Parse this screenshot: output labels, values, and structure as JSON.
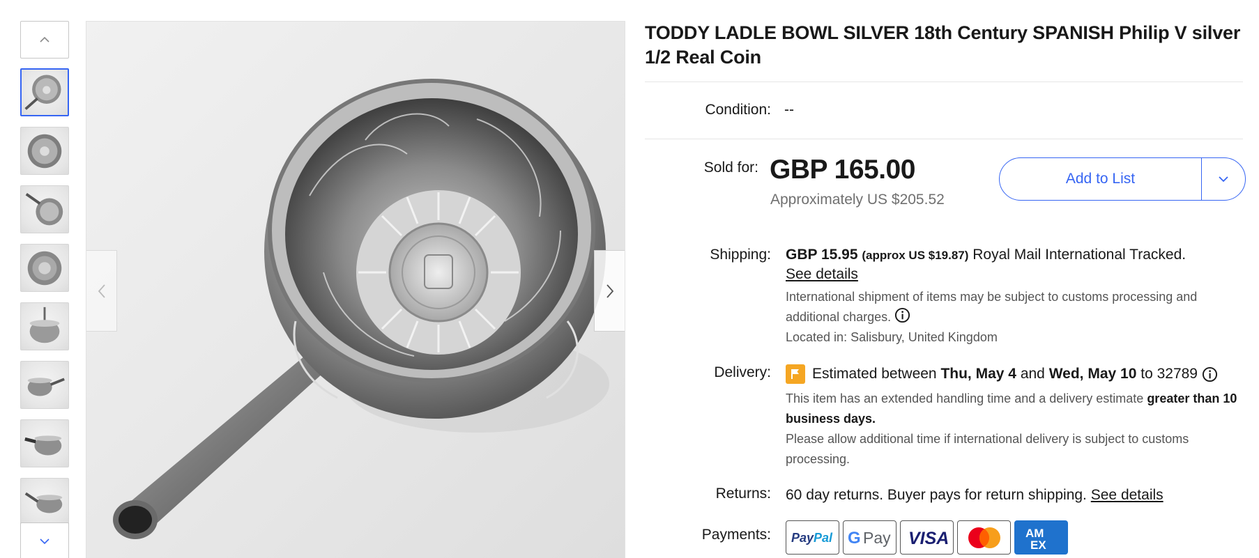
{
  "listing": {
    "title": "TODDY LADLE BOWL SILVER 18th Century SPANISH Philip V silver 1/2 Real Coin"
  },
  "condition": {
    "label": "Condition:",
    "value": "--"
  },
  "price": {
    "label": "Sold for:",
    "amount": "GBP 165.00",
    "approx": "Approximately US $205.52"
  },
  "add_to_list": {
    "label": "Add to List"
  },
  "shipping": {
    "label": "Shipping:",
    "cost": "GBP 15.95",
    "cost_approx": "(approx US $19.87)",
    "service": "Royal Mail International Tracked.",
    "see_details": "See details",
    "customs_note": "International shipment of items may be subject to customs processing and additional charges.",
    "location": "Located in: Salisbury, United Kingdom"
  },
  "delivery": {
    "label": "Delivery:",
    "prefix": "Estimated between",
    "start_date": "Thu, May 4",
    "and_word": "and",
    "end_date": "Wed, May 10",
    "to_word": "to",
    "zip": "32789",
    "handling_note": "This item has an extended handling time and a delivery estimate",
    "handling_note_bold": "greater than 10 business days.",
    "intl_note": "Please allow additional time if international delivery is subject to customs processing."
  },
  "returns": {
    "label": "Returns:",
    "text": "60 day returns. Buyer pays for return shipping.",
    "see_details": "See details"
  },
  "payments": {
    "label": "Payments:",
    "methods": [
      "PayPal",
      "G Pay",
      "VISA",
      "Mastercard",
      "AMEX"
    ]
  },
  "gallery": {
    "thumbnail_count": 8,
    "selected_index": 0
  },
  "colors": {
    "accent_blue": "#3665f3",
    "delivery_flag": "#f5a623",
    "text_primary": "#191919",
    "text_secondary": "#707070",
    "amex_blue": "#1f72cd"
  },
  "icons": [
    "chevron-up-icon",
    "chevron-down-icon",
    "chevron-left-icon",
    "chevron-right-icon",
    "info-icon",
    "flag-icon"
  ]
}
